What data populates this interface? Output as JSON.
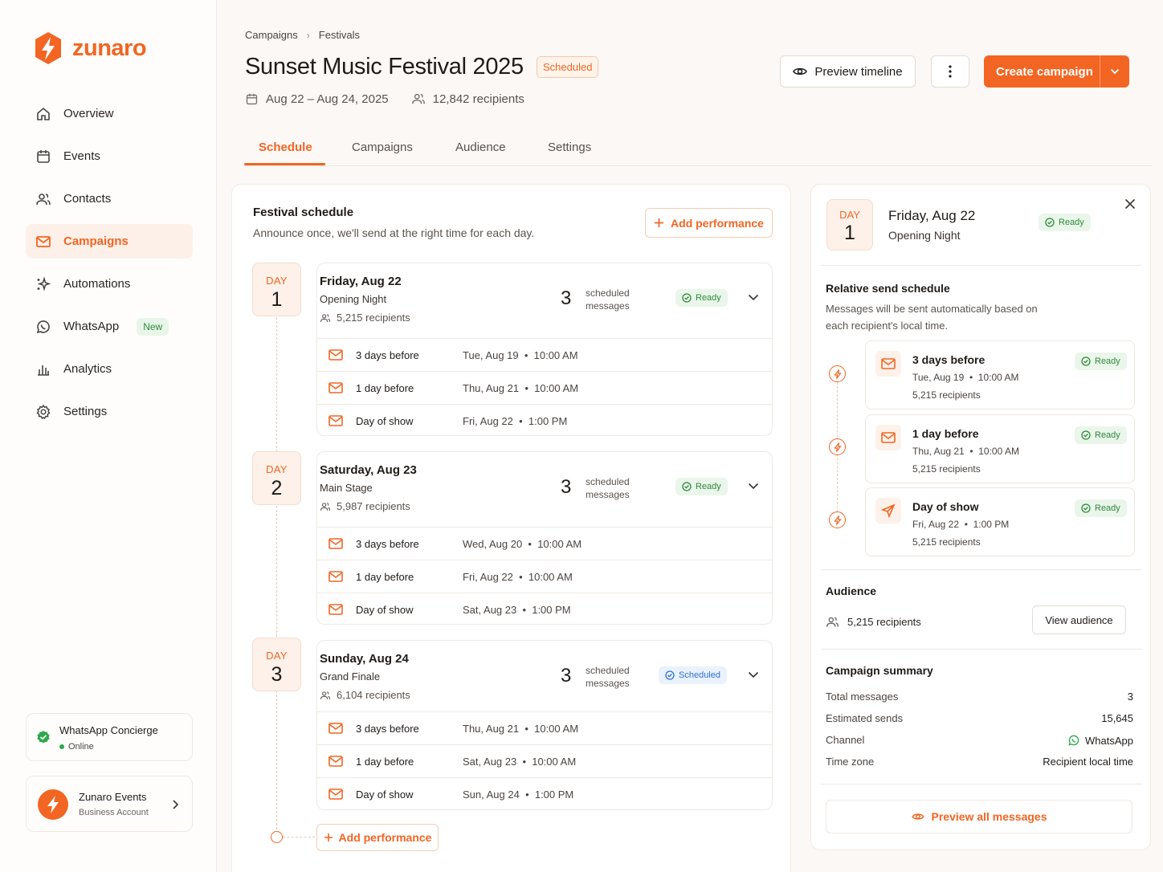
{
  "brand": {
    "name": "zunaro",
    "accent": "#f26522"
  },
  "sidebar": {
    "items": [
      {
        "label": "Overview",
        "icon": "home-icon",
        "active": false
      },
      {
        "label": "Events",
        "icon": "calendar-icon",
        "active": false
      },
      {
        "label": "Contacts",
        "icon": "users-icon",
        "active": false
      },
      {
        "label": "Campaigns",
        "icon": "mail-icon",
        "active": true
      },
      {
        "label": "Automations",
        "icon": "sparkle-icon",
        "active": false
      },
      {
        "label": "WhatsApp",
        "icon": "whatsapp-icon",
        "active": false,
        "badge": "New"
      },
      {
        "label": "Analytics",
        "icon": "bar-chart-icon",
        "active": false
      },
      {
        "label": "Settings",
        "icon": "gear-icon",
        "active": false
      }
    ],
    "concierge": {
      "title": "WhatsApp Concierge",
      "status": "Online"
    },
    "account": {
      "name": "Zunaro Events",
      "type": "Business Account"
    }
  },
  "header": {
    "breadcrumb": [
      "Campaigns",
      "Festivals"
    ],
    "title": "Sunset Music Festival 2025",
    "status": "Scheduled",
    "dates": "Aug 22 – Aug 24, 2025",
    "recipients": "12,842 recipients",
    "preview_label": "Preview timeline",
    "create_label": "Create campaign"
  },
  "tabs": [
    "Schedule",
    "Campaigns",
    "Audience",
    "Settings"
  ],
  "schedule": {
    "title": "Festival schedule",
    "subtitle": "Announce once, we'll send at the right time for each day.",
    "add_label": "Add performance",
    "days": [
      {
        "day_label": "DAY",
        "day_num": "1",
        "date": "Friday, Aug 22",
        "stage": "Opening Night",
        "recipients": "5,215 recipients",
        "count": "3",
        "count_label_1": "scheduled",
        "count_label_2": "messages",
        "status": "Ready",
        "status_kind": "ready",
        "messages": [
          {
            "label": "3 days before",
            "when": "Tue, Aug 19  •  10:00 AM"
          },
          {
            "label": "1 day before",
            "when": "Thu, Aug 21  •  10:00 AM"
          },
          {
            "label": "Day of show",
            "when": "Fri, Aug 22  •  1:00 PM"
          }
        ]
      },
      {
        "day_label": "DAY",
        "day_num": "2",
        "date": "Saturday, Aug 23",
        "stage": "Main Stage",
        "recipients": "5,987 recipients",
        "count": "3",
        "count_label_1": "scheduled",
        "count_label_2": "messages",
        "status": "Ready",
        "status_kind": "ready",
        "messages": [
          {
            "label": "3 days before",
            "when": "Wed, Aug 20  •  10:00 AM"
          },
          {
            "label": "1 day before",
            "when": "Fri, Aug 22  •  10:00 AM"
          },
          {
            "label": "Day of show",
            "when": "Sat, Aug 23  •  1:00 PM"
          }
        ]
      },
      {
        "day_label": "DAY",
        "day_num": "3",
        "date": "Sunday, Aug 24",
        "stage": "Grand Finale",
        "recipients": "6,104 recipients",
        "count": "3",
        "count_label_1": "scheduled",
        "count_label_2": "messages",
        "status": "Scheduled",
        "status_kind": "sched",
        "messages": [
          {
            "label": "3 days before",
            "when": "Thu, Aug 21  •  10:00 AM"
          },
          {
            "label": "1 day before",
            "when": "Sat, Aug 23  •  10:00 AM"
          },
          {
            "label": "Day of show",
            "when": "Sun, Aug 24  •  1:00 PM"
          }
        ]
      }
    ]
  },
  "detail": {
    "day_label": "DAY",
    "day_num": "1",
    "date": "Friday, Aug 22",
    "stage": "Opening Night",
    "status": "Ready",
    "relative": {
      "title": "Relative send schedule",
      "subtitle": "Messages will be sent automatically based on each recipient's local time.",
      "items": [
        {
          "label": "3 days before",
          "when": "Tue, Aug 19  •  10:00 AM",
          "recipients": "5,215 recipients",
          "status": "Ready",
          "icon": "mail-icon"
        },
        {
          "label": "1 day before",
          "when": "Thu, Aug 21  •  10:00 AM",
          "recipients": "5,215 recipients",
          "status": "Ready",
          "icon": "mail-icon"
        },
        {
          "label": "Day of show",
          "when": "Fri, Aug 22  •  1:00 PM",
          "recipients": "5,215 recipients",
          "status": "Ready",
          "icon": "send-icon"
        }
      ]
    },
    "audience": {
      "title": "Audience",
      "recipients": "5,215 recipients",
      "view_label": "View audience"
    },
    "summary": {
      "title": "Campaign summary",
      "rows": [
        {
          "k": "Total messages",
          "v": "3"
        },
        {
          "k": "Estimated sends",
          "v": "15,645"
        },
        {
          "k": "Channel",
          "v": "WhatsApp"
        },
        {
          "k": "Time zone",
          "v": "Recipient local time"
        }
      ]
    },
    "preview_all_label": "Preview all messages"
  }
}
